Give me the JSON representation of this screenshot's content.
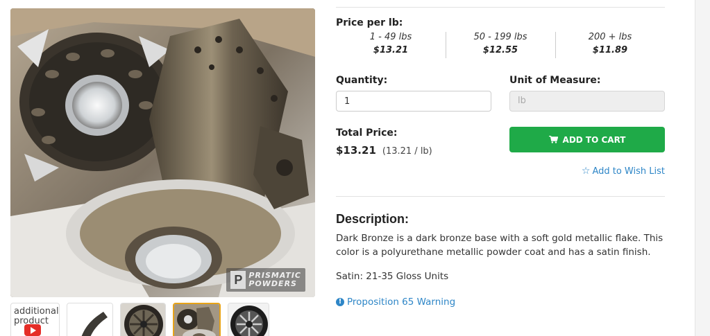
{
  "product_image": {
    "alt": "Dark Bronze powder coated motorcycle hub",
    "watermark_line1": "PRISMATIC",
    "watermark_line2": "POWDERS",
    "watermark_logo": "P"
  },
  "thumbnails": [
    {
      "type": "video",
      "alt_text": "additional product",
      "icon": "youtube-play-icon"
    },
    {
      "type": "image",
      "subject": "bronze swatch"
    },
    {
      "type": "image",
      "subject": "bronze wheel"
    },
    {
      "type": "image",
      "subject": "bronze hub",
      "active": true
    },
    {
      "type": "image",
      "subject": "dark wheel"
    }
  ],
  "pricing": {
    "heading": "Price per lb:",
    "tiers": [
      {
        "range": "1 - 49 lbs",
        "price": "$13.21"
      },
      {
        "range": "50 - 199 lbs",
        "price": "$12.55"
      },
      {
        "range": "200 + lbs",
        "price": "$11.89"
      }
    ]
  },
  "order": {
    "quantity_label": "Quantity:",
    "quantity_value": "1",
    "unit_label": "Unit of Measure:",
    "unit_value": "lb",
    "total_label": "Total Price:",
    "total_value": "$13.21",
    "total_detail": "(13.21 / lb)",
    "add_to_cart": "ADD TO CART",
    "wish_list": "Add to Wish List"
  },
  "description": {
    "heading": "Description:",
    "text": "Dark Bronze is a dark bronze base with a soft gold metallic flake. This color is a polyurethane metallic powder coat and has a satin finish.",
    "satin": "Satin: 21-35 Gloss Units",
    "prop65": "Proposition 65 Warning"
  },
  "colors": {
    "accent_green": "#1faa48",
    "link_blue": "#2e86c7",
    "active_thumb_border": "#e8a317",
    "bronze": "#6b5f4b"
  }
}
